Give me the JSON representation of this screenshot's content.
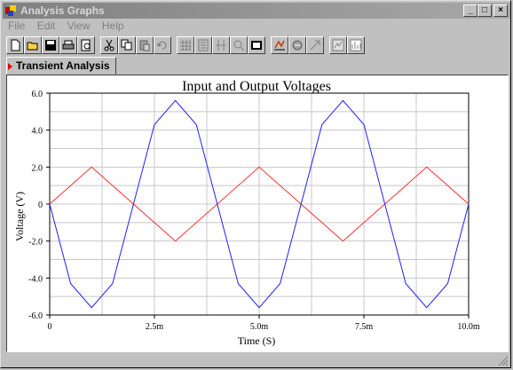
{
  "window": {
    "title": "Analysis Graphs",
    "app_icon": "multisim-icon",
    "controls": [
      "minimize",
      "maximize",
      "close"
    ]
  },
  "menu": [
    "File",
    "Edit",
    "View",
    "Help"
  ],
  "toolbar": {
    "buttons": [
      "new-icon",
      "open-icon",
      "save-icon",
      "print-icon",
      "print-preview-icon",
      "cut-icon",
      "copy-icon",
      "paste-icon",
      "undo-icon",
      "grid-icon",
      "legend-icon",
      "cursors-icon",
      "zoom-icon",
      "toggle-background-icon",
      "properties-icon",
      "overlay-icon",
      "export-icon",
      "restore-icon",
      "view-chart-icon"
    ]
  },
  "tabs": [
    {
      "label": "Transient Analysis",
      "active": true
    }
  ],
  "colors": {
    "input": "#ff3030",
    "output": "#2020ff",
    "grid": "#c8c8c8"
  },
  "chart_data": {
    "type": "line",
    "title": "Input and Output Voltages",
    "xlabel": "Time (S)",
    "ylabel": "Voltage (V)",
    "xlim": [
      0,
      10
    ],
    "ylim": [
      -6,
      6
    ],
    "x_unit_scale": "m",
    "xticks": [
      "0",
      "2.5m",
      "5.0m",
      "7.5m",
      "10.0m"
    ],
    "xtick_values": [
      0,
      2.5,
      5,
      7.5,
      10
    ],
    "yticks": [
      "6.0",
      "4.0",
      "2.0",
      "0",
      "-2.0",
      "-4.0",
      "-6.0"
    ],
    "ytick_values": [
      6,
      4,
      2,
      0,
      -2,
      -4,
      -6
    ],
    "grid": true,
    "series": [
      {
        "color": "#ff3030",
        "x": [
          0,
          1,
          3,
          5,
          7,
          9,
          10
        ],
        "y": [
          0,
          2.0,
          -2.0,
          2.0,
          -2.0,
          2.0,
          0
        ]
      },
      {
        "color": "#2020ff",
        "x": [
          0,
          0.5,
          1.0,
          1.5,
          2.0,
          2.5,
          3.0,
          3.5,
          4.0,
          4.5,
          5.0,
          5.5,
          6.0,
          6.5,
          7.0,
          7.5,
          8.0,
          8.5,
          9.0,
          9.5,
          10.0
        ],
        "y": [
          0,
          -4.3,
          -5.6,
          -4.3,
          0,
          4.3,
          5.6,
          4.3,
          0,
          -4.3,
          -5.6,
          -4.3,
          0,
          4.3,
          5.6,
          4.3,
          0,
          -4.3,
          -5.6,
          -4.3,
          0
        ]
      }
    ]
  }
}
